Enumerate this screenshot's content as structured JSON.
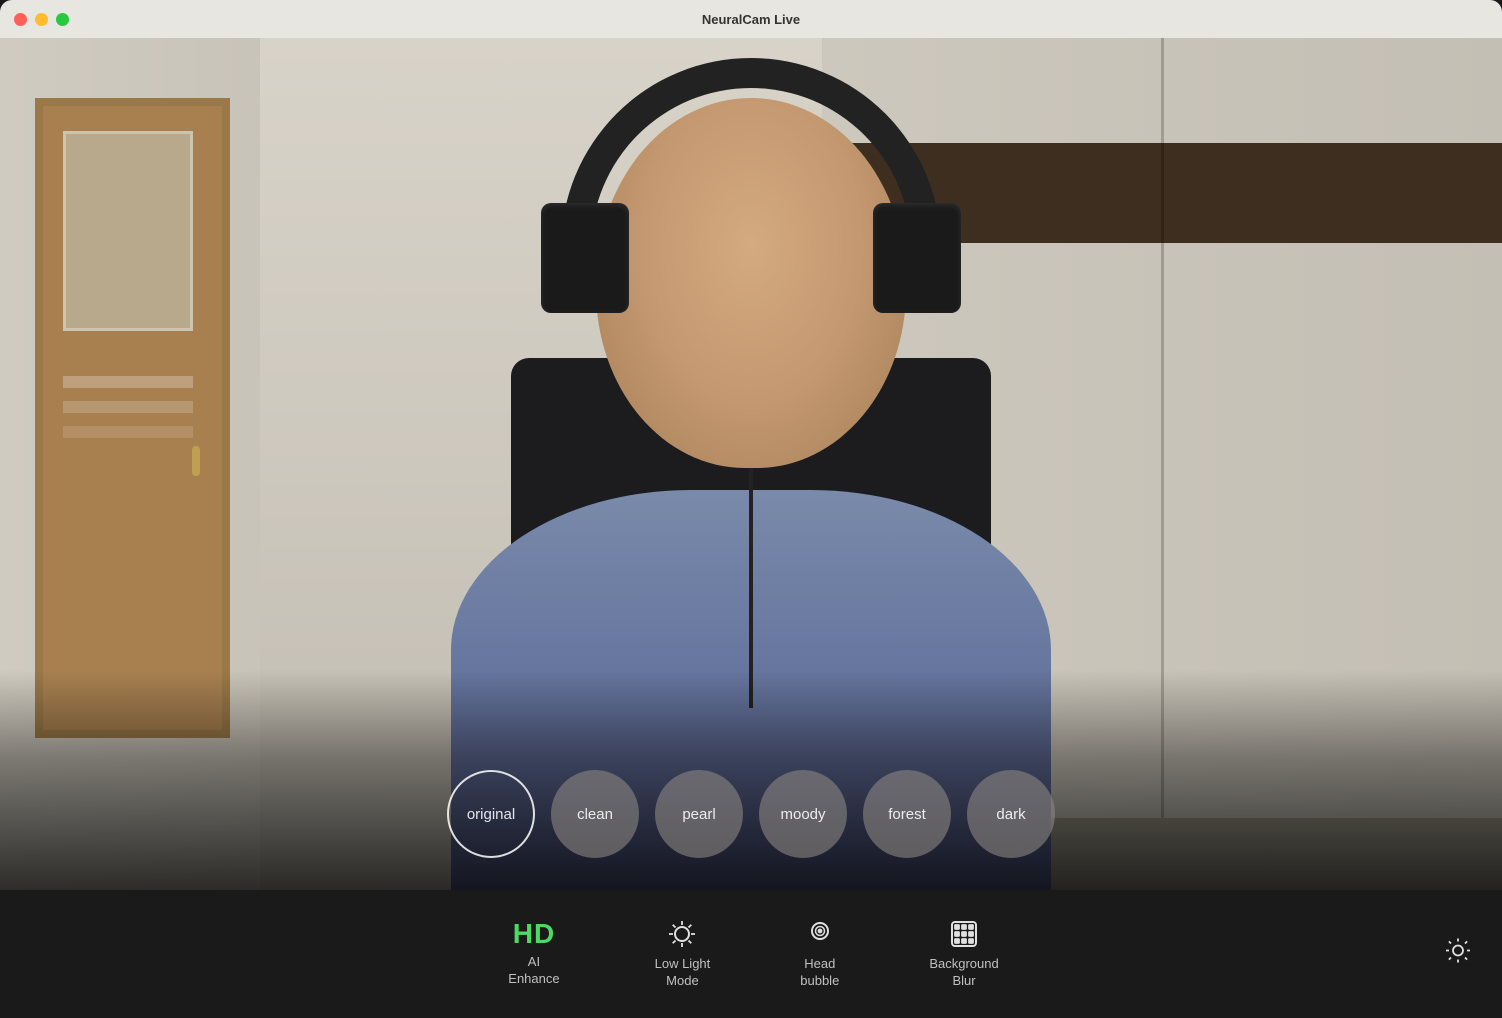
{
  "window": {
    "title": "NeuralCam Live"
  },
  "titlebar": {
    "close_label": "",
    "minimize_label": "",
    "maximize_label": ""
  },
  "filters": [
    {
      "id": "original",
      "label": "original",
      "selected": true
    },
    {
      "id": "clean",
      "label": "clean",
      "selected": false
    },
    {
      "id": "pearl",
      "label": "pearl",
      "selected": false
    },
    {
      "id": "moody",
      "label": "moody",
      "selected": false
    },
    {
      "id": "forest",
      "label": "forest",
      "selected": false
    },
    {
      "id": "dark",
      "label": "dark",
      "selected": false
    }
  ],
  "toolbar": {
    "hd_label": "HD",
    "ai_enhance_label": "AI\nEnhance",
    "low_light_mode_label": "Low Light\nMode",
    "head_bubble_label": "Head\nbubble",
    "background_blur_label": "Background\nBlur",
    "settings_label": ""
  }
}
